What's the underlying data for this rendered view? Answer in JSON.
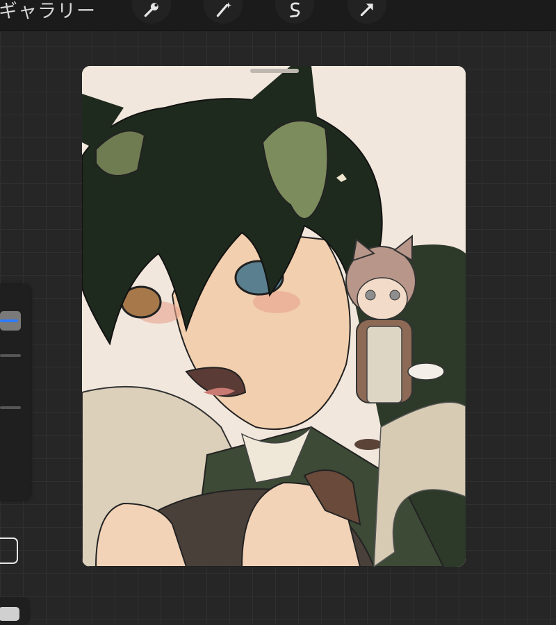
{
  "topbar": {
    "gallery_label": "ギャラリー",
    "tools": [
      {
        "name": "wrench-icon"
      },
      {
        "name": "magic-wand-icon"
      },
      {
        "name": "selection-s-icon"
      },
      {
        "name": "transform-arrow-icon"
      }
    ]
  },
  "sidebar": {
    "brush_size": 0.85,
    "opacity": 0.5
  },
  "canvas": {
    "background": "#f1e7dc",
    "artwork": "illustration"
  },
  "colors": {
    "ui_bg": "#262626",
    "accent_blue": "#2f7bff"
  }
}
